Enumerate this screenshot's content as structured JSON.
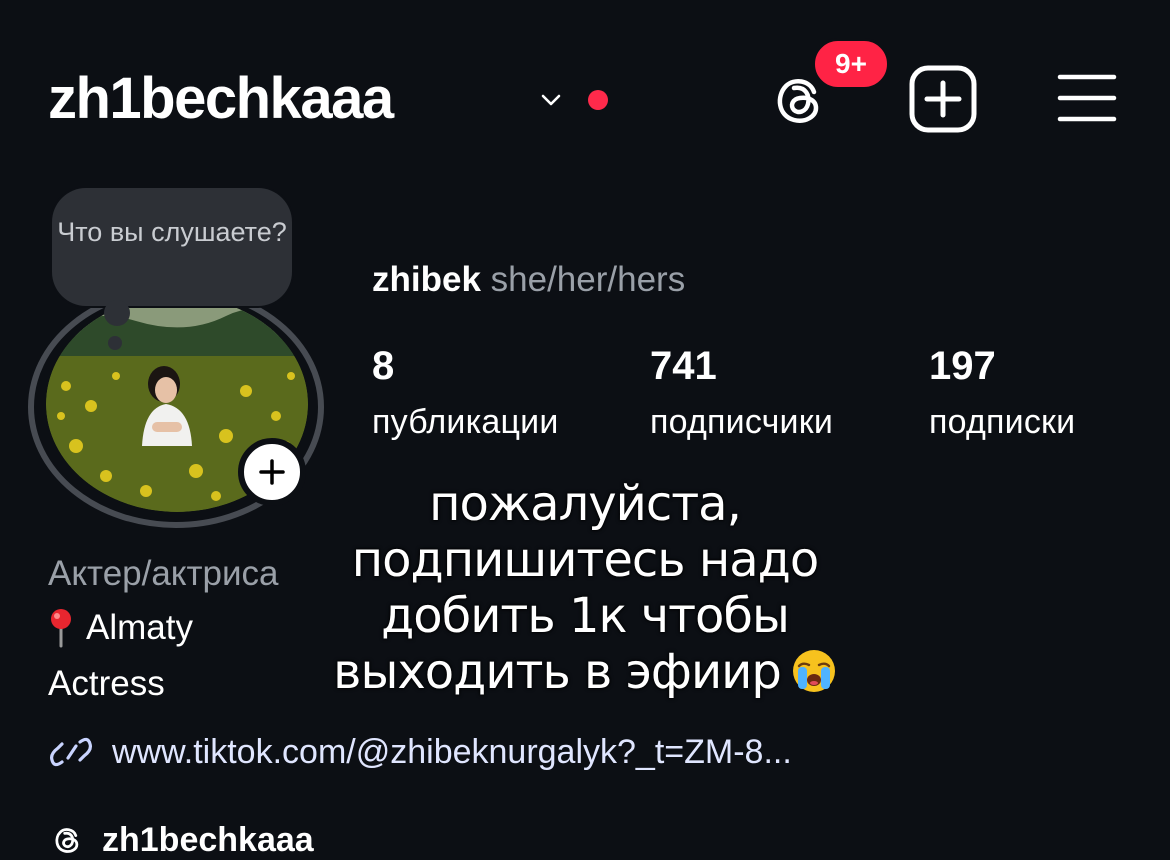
{
  "header": {
    "username": "zh1bechkaaa",
    "notification_badge": "9+",
    "accent_red": "#ff2a4b"
  },
  "note": {
    "text": "Что вы слушаете?"
  },
  "profile": {
    "display_name": "zhibek",
    "pronouns": "she/her/hers",
    "stats": [
      {
        "value": "8",
        "label": "публикации"
      },
      {
        "value": "741",
        "label": "подписчики"
      },
      {
        "value": "197",
        "label": "подписки"
      }
    ]
  },
  "bio": {
    "category": "Актер/актриса",
    "location": "Almaty",
    "line2": "Actress",
    "link": "www.tiktok.com/@zhibeknurgalyk?_t=ZM-8...",
    "threads_handle": "zh1bechkaaa"
  },
  "overlay": {
    "lines": [
      "пожалуйста,",
      "подпишитесь надо",
      "добить 1к чтобы",
      "выходить в эфиир"
    ]
  },
  "icons": {
    "threads": "threads-icon",
    "create": "plus-square-icon",
    "menu": "hamburger-menu-icon",
    "pin": "round-pushpin-icon",
    "link": "link-icon",
    "emoji": "loudly-crying-face-emoji"
  }
}
